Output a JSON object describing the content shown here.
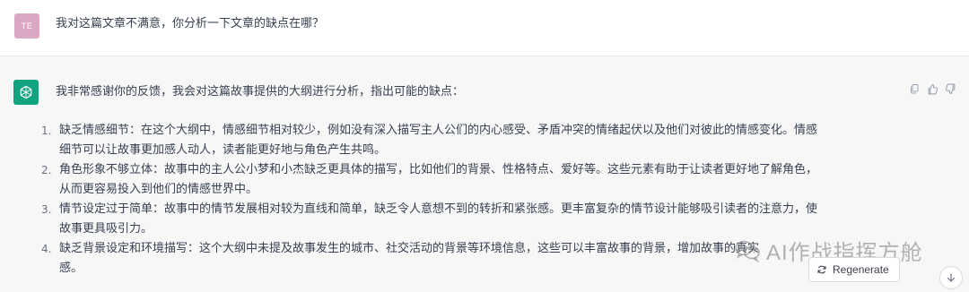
{
  "user_message": {
    "avatar_initials": "TE",
    "avatar_color": "#dca7c4",
    "text": "我对这篇文章不满意，你分析一下文章的缺点在哪？"
  },
  "assistant_message": {
    "avatar_color": "#10a37f",
    "intro": "我非常感谢你的反馈，我会对这篇故事提供的大纲进行分析，指出可能的缺点：",
    "items": [
      {
        "number": "1.",
        "lines": [
          "缺乏情感细节：在这个大纲中，情感细节相对较少，例如没有深入描写主人公们的内心感受、矛盾冲突的情绪起伏以及他们对彼此的情感变化。情感",
          "细节可以让故事更加感人动人，读者能更好地与角色产生共鸣。"
        ]
      },
      {
        "number": "2.",
        "lines": [
          "角色形象不够立体：故事中的主人公小梦和小杰缺乏更具体的描写，比如他们的背景、性格特点、爱好等。这些元素有助于让读者更好地了解角色，",
          "从而更容易投入到他们的情感世界中。"
        ]
      },
      {
        "number": "3.",
        "lines": [
          "情节设定过于简单：故事中的情节发展相对较为直线和简单，缺乏令人意想不到的转折和紧张感。更丰富复杂的情节设计能够吸引读者的注意力，使",
          "故事更具吸引力。"
        ]
      },
      {
        "number": "4.",
        "lines": [
          "缺乏背景设定和环境描写：这个大纲中未提及故事发生的城市、社交活动的背景等环境信息，这些可以丰富故事的背景，增加故事的真实",
          "感。"
        ]
      }
    ],
    "actions": [
      "copy-icon",
      "thumbs-up-icon",
      "thumbs-down-icon"
    ]
  },
  "regenerate": {
    "label": "Regenerate"
  },
  "watermark": {
    "text": "AI作战指挥方舱"
  }
}
